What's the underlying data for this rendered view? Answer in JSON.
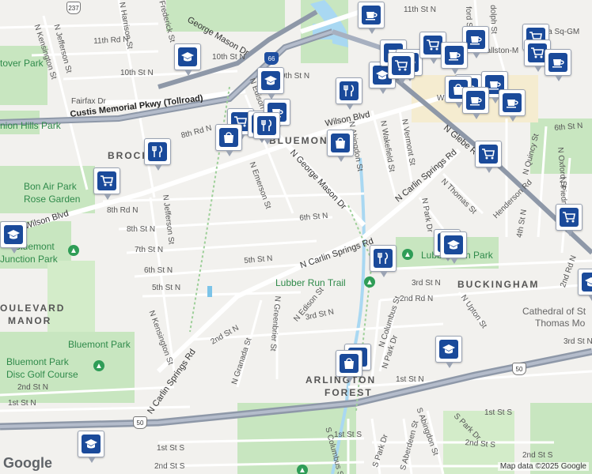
{
  "roads": {
    "custis": "Custis Memorial Pkwy (Tollroad)",
    "wilson": "Wilson Blvd",
    "wilson_e": "Wilson Blvd",
    "george_mason": "N George Mason Dr",
    "george_mason_n": "George Mason Dr",
    "carlin": "N Carlin Springs Rd",
    "carlin_s": "N Carlin Springs Rd",
    "carlin_ne": "N Carlin Springs Rd",
    "glebe": "N Glebe Rd",
    "fairfax": "Fairfax Dr",
    "r_11th": "11th St N",
    "r_11th_rd": "11th Rd N",
    "r_10th": "10th St N",
    "r_10th_e": "10th St N",
    "r_9th": "9th St N",
    "r_8th_rd": "8th Rd N",
    "r_8th_rd_w": "8th Rd N",
    "r_8th": "8th St N",
    "r_7th": "7th St N",
    "r_6th": "6th St N",
    "r_6th_c": "6th St N",
    "r_6th_e": "6th St N",
    "r_5th": "5th St N",
    "r_5th_c": "5th St N",
    "r_4th": "4th St N",
    "r_3rd": "3rd St N",
    "r_3rd_c": "3rd St N",
    "r_2nd": "2nd St N",
    "r_2nd_w": "2nd St N",
    "r_2nd_rd": "2nd Rd N",
    "r_2nd_rd_e": "2nd Rd N",
    "r_1st": "1st St N",
    "r_1st_w": "1st St N",
    "r_1st_c": "1st St N",
    "r_1st_s": "1st St S",
    "r_1st_s_e": "1st St S",
    "r_2nd_s": "2nd St S",
    "r_2nd_s_e": "2nd St S",
    "r_2nd_s_f": "2nd St S",
    "r_1st_s_c": "1st St S",
    "r_3rd_e": "3rd St N",
    "r_11th_n": "11th St N",
    "r_10th_n": "10th St N",
    "harrison": "N Harrison St",
    "kensington": "N Kensington St",
    "kensington_s": "N Kensington St",
    "jefferson": "N Jefferson St",
    "jefferson_s": "N Jefferson St",
    "frederick": "Frederick St",
    "emerson": "N Emerson St",
    "edison_n": "N Edison St",
    "edison": "N Edison St",
    "greenbrier": "N Greenbrier St",
    "granada": "N Granada St",
    "abingdon": "N Abingdon St",
    "wakefield": "N Wakefield St",
    "vermont": "N Vermont St",
    "thomas": "N Thomas St",
    "park": "N Park Dr",
    "park_s": "N Park Dr",
    "columbus": "N Columbus St",
    "upton": "N Upton St",
    "henderson": "Henderson Rd",
    "quincy": "N Quincy St",
    "piedmont": "N Piedmont St",
    "oxford": "N Oxford St",
    "s_columbus": "S Columbus St",
    "s_park": "S Park Dr",
    "s_aberdeen": "S Aberdeen St",
    "s_abingdon": "S Abingdon St",
    "s_park_e": "S Park Dr",
    "ford": "ford St",
    "dolph": "dolph St",
    "ballston": "Ballston-M",
    "virginia": "ia Sq-GM",
    "w_label": "W"
  },
  "places": {
    "bluemont_hood": "BLUEMONT",
    "brock": "BROCK",
    "buckingham": "BUCKINGHAM",
    "arlington": "ARLINGTON",
    "forest": "FOREST",
    "boulevard": "OULEVARD",
    "manor": "MANOR",
    "overpark": "tover Park",
    "hills_park": "nion Hills Park",
    "bon_air": "Bon Air Park",
    "rose_garden": "Rose Garden",
    "bluemont_junction": "Bluemont",
    "junction_park": "Junction Park",
    "bluemont_park": "Bluemont Park",
    "disc_golf": "Bluemont Park",
    "disc_golf_2": "Disc Golf Course",
    "lubber_run_park": "Lubber Run Park",
    "lubber_run_trail": "Lubber Run Trail",
    "cathedral": "Cathedral of St",
    "cathedral_2": "Thomas Mo"
  },
  "shields": {
    "i66": "66",
    "us50_w": "50",
    "us50_e": "50",
    "r237": "237"
  },
  "pin_icons": {
    "school": "graduation-cap",
    "restaurant": "fork-knife",
    "grocery": "shopping-cart",
    "cafe": "coffee-cup",
    "shopping": "shopping-bag"
  },
  "footer": {
    "logo": "Google",
    "credit": "Map data ©2025 Google"
  }
}
